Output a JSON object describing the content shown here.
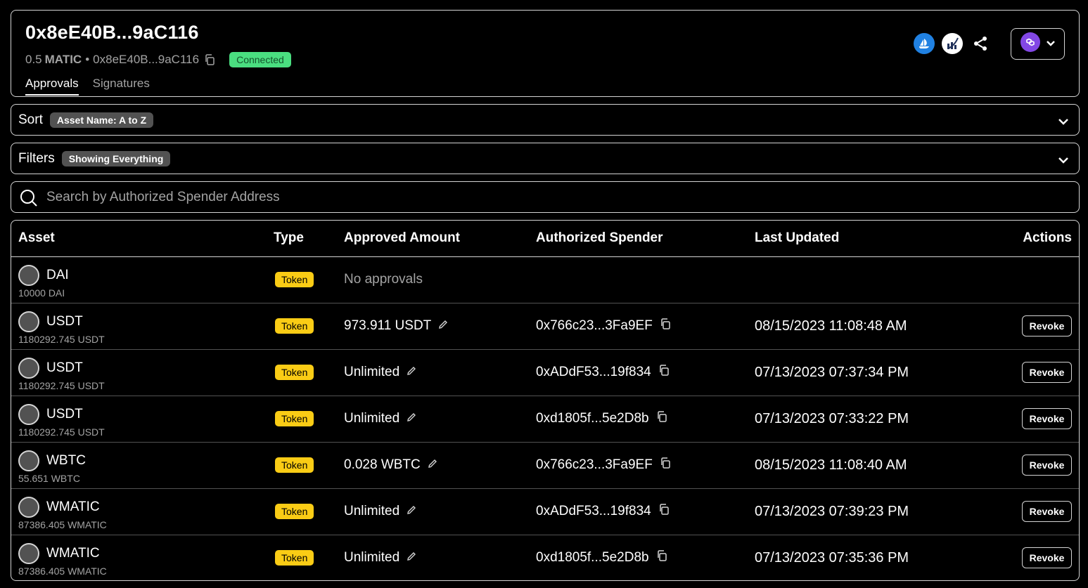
{
  "header": {
    "title": "0x8eE40B...9aC116",
    "balance_amount": "0.5",
    "balance_unit": "MATIC",
    "separator": "•",
    "address_short": "0x8eE40B...9aC116",
    "status_badge": "Connected",
    "tabs": [
      {
        "label": "Approvals",
        "active": true
      },
      {
        "label": "Signatures",
        "active": false
      }
    ],
    "icons": [
      "opensea-icon",
      "etherscan-icon",
      "share-icon"
    ],
    "chain_icon": "polygon-icon"
  },
  "sort": {
    "label": "Sort",
    "value": "Asset Name: A to Z"
  },
  "filters": {
    "label": "Filters",
    "value": "Showing Everything"
  },
  "search": {
    "placeholder": "Search by Authorized Spender Address"
  },
  "table": {
    "headers": {
      "asset": "Asset",
      "type": "Type",
      "amount": "Approved Amount",
      "spender": "Authorized Spender",
      "updated": "Last Updated",
      "actions": "Actions"
    },
    "rows": [
      {
        "asset": "DAI",
        "balance": "10000 DAI",
        "type": "Token",
        "amount": "No approvals",
        "spender": "",
        "updated": "",
        "action": ""
      },
      {
        "asset": "USDT",
        "balance": "1180292.745 USDT",
        "type": "Token",
        "amount": "973.911 USDT",
        "spender": "0x766c23...3Fa9EF",
        "updated": "08/15/2023 11:08:48 AM",
        "action": "Revoke"
      },
      {
        "asset": "USDT",
        "balance": "1180292.745 USDT",
        "type": "Token",
        "amount": "Unlimited",
        "spender": "0xADdF53...19f834",
        "updated": "07/13/2023 07:37:34 PM",
        "action": "Revoke"
      },
      {
        "asset": "USDT",
        "balance": "1180292.745 USDT",
        "type": "Token",
        "amount": "Unlimited",
        "spender": "0xd1805f...5e2D8b",
        "updated": "07/13/2023 07:33:22 PM",
        "action": "Revoke"
      },
      {
        "asset": "WBTC",
        "balance": "55.651 WBTC",
        "type": "Token",
        "amount": "0.028 WBTC",
        "spender": "0x766c23...3Fa9EF",
        "updated": "08/15/2023 11:08:40 AM",
        "action": "Revoke"
      },
      {
        "asset": "WMATIC",
        "balance": "87386.405 WMATIC",
        "type": "Token",
        "amount": "Unlimited",
        "spender": "0xADdF53...19f834",
        "updated": "07/13/2023 07:39:23 PM",
        "action": "Revoke"
      },
      {
        "asset": "WMATIC",
        "balance": "87386.405 WMATIC",
        "type": "Token",
        "amount": "Unlimited",
        "spender": "0xd1805f...5e2D8b",
        "updated": "07/13/2023 07:35:36 PM",
        "action": "Revoke"
      }
    ]
  },
  "colors": {
    "accent_connected": "#4ade80",
    "token_badge": "#facc15",
    "polygon": "#8247e5",
    "opensea": "#2081e2"
  }
}
